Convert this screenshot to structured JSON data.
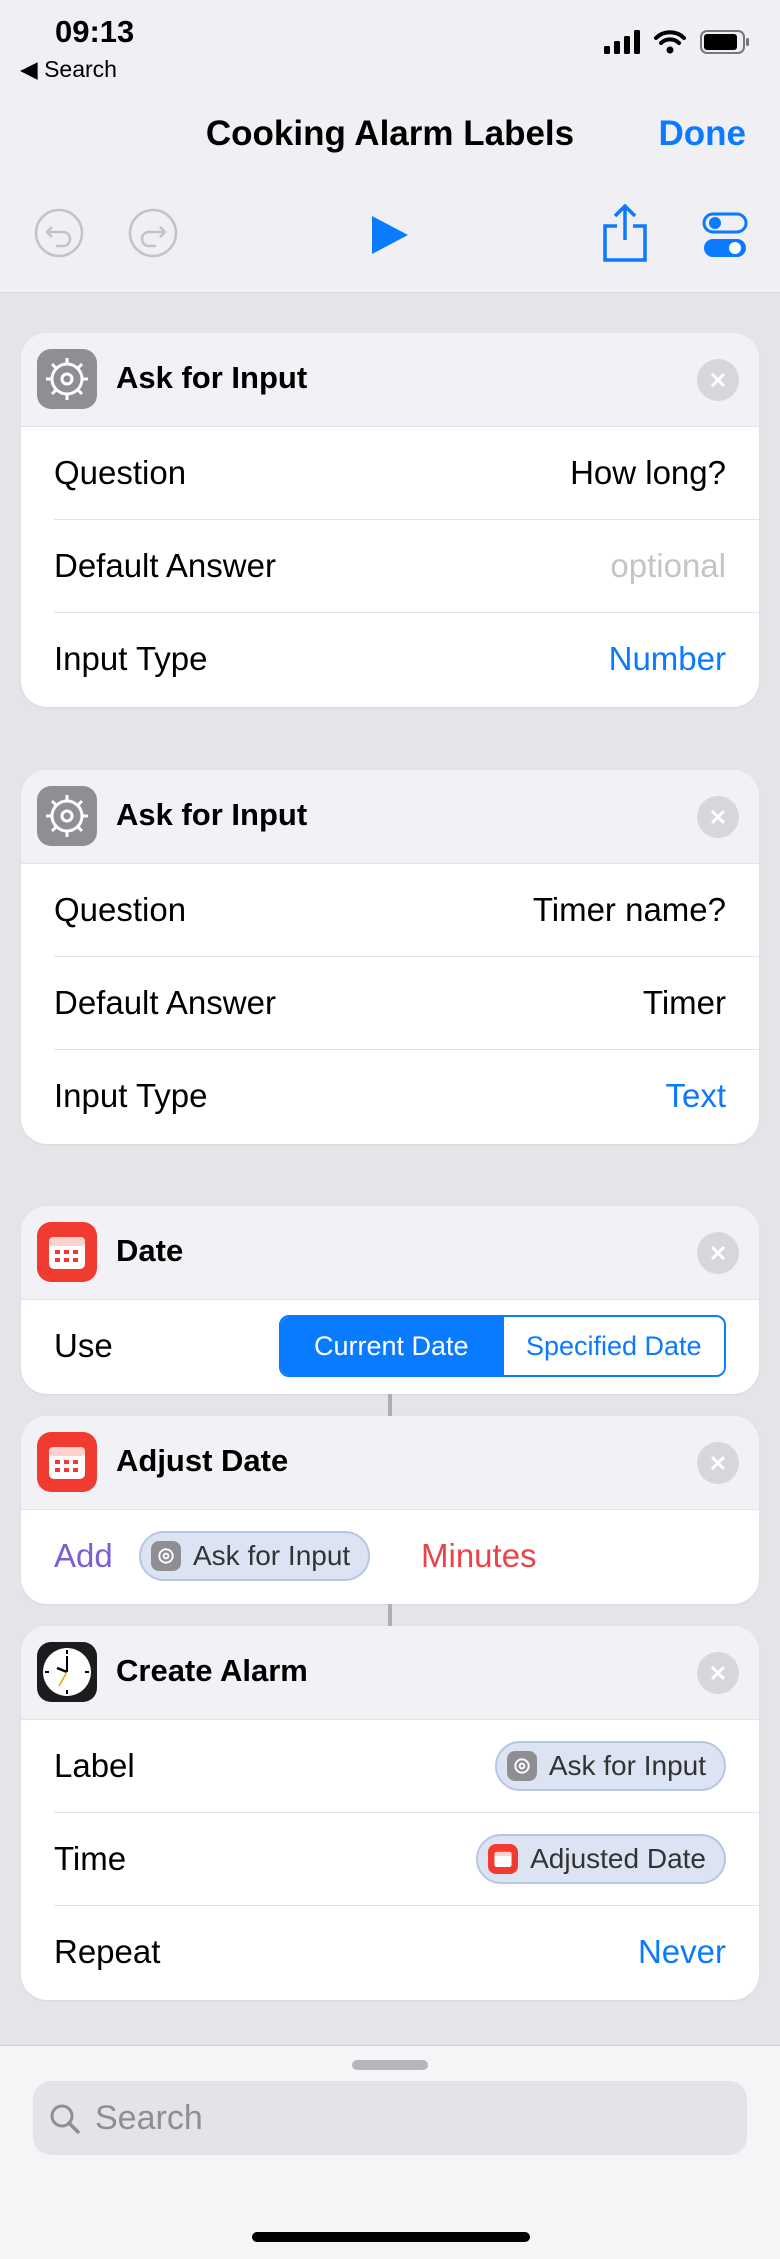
{
  "status": {
    "time": "09:13",
    "back": "◀ Search"
  },
  "nav": {
    "title": "Cooking Alarm Labels",
    "done": "Done"
  },
  "actions": [
    {
      "title": "Ask for Input",
      "icon": "gear-icon",
      "rows": [
        {
          "label": "Question",
          "value": "How long?"
        },
        {
          "label": "Default Answer",
          "placeholder": "optional"
        },
        {
          "label": "Input Type",
          "value": "Number"
        }
      ]
    },
    {
      "title": "Ask for Input",
      "icon": "gear-icon",
      "rows": [
        {
          "label": "Question",
          "value": "Timer name?"
        },
        {
          "label": "Default Answer",
          "value": "Timer"
        },
        {
          "label": "Input Type",
          "value": "Text"
        }
      ]
    },
    {
      "title": "Date",
      "icon": "calendar-icon",
      "use_label": "Use",
      "segments": [
        "Current Date",
        "Specified Date"
      ],
      "selected": "Current Date"
    },
    {
      "title": "Adjust Date",
      "icon": "calendar-icon",
      "operation": "Add",
      "amount_token": "Ask for Input",
      "unit": "Minutes"
    },
    {
      "title": "Create Alarm",
      "icon": "clock-icon",
      "rows": [
        {
          "label": "Label",
          "token": "Ask for Input"
        },
        {
          "label": "Time",
          "token": "Adjusted Date"
        },
        {
          "label": "Repeat",
          "value": "Never"
        }
      ]
    }
  ],
  "search": {
    "placeholder": "Search"
  },
  "colors": {
    "accent": "#0a7aff",
    "variable": "#7b5fd4",
    "unit": "#e8444a",
    "background": "#e4e4e9"
  }
}
